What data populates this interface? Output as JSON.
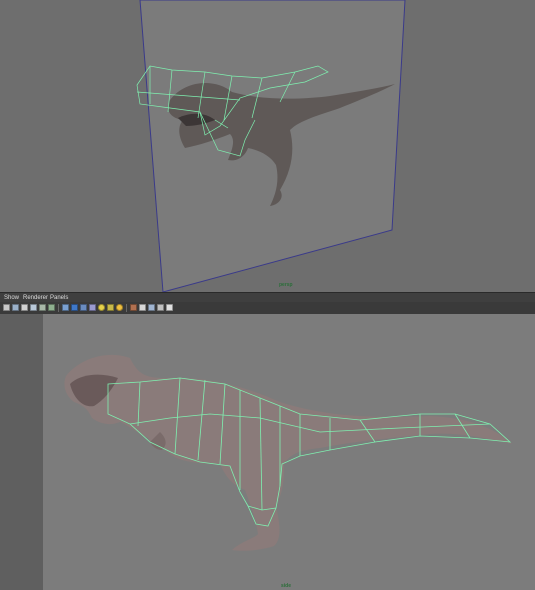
{
  "viewports": {
    "perspective": {
      "camera_label": "persp"
    },
    "side": {
      "camera_label": "side"
    }
  },
  "panel_menu": {
    "items": [
      "Show",
      "Renderer",
      "Panels"
    ]
  },
  "toolbar": {
    "icons": [
      "select-camera-icon",
      "camera-attributes-icon",
      "bookmark-icon",
      "image-plane-icon",
      "grid-icon",
      "film-gate-icon",
      "resolution-gate-icon",
      "wireframe-icon",
      "smooth-shade-icon",
      "wireframe-on-shaded-icon",
      "texture-icon",
      "lighting-icon",
      "shadows-icon",
      "ambient-occlusion-icon",
      "xray-icon",
      "isolate-select-icon",
      "xray-joints-icon"
    ]
  },
  "colors": {
    "panel_bg": "#6e6e6e",
    "wire_green": "#7ff0b0",
    "image_plane_edge": "#3a3a8a",
    "camera_label_green": "#2c6e3a"
  }
}
